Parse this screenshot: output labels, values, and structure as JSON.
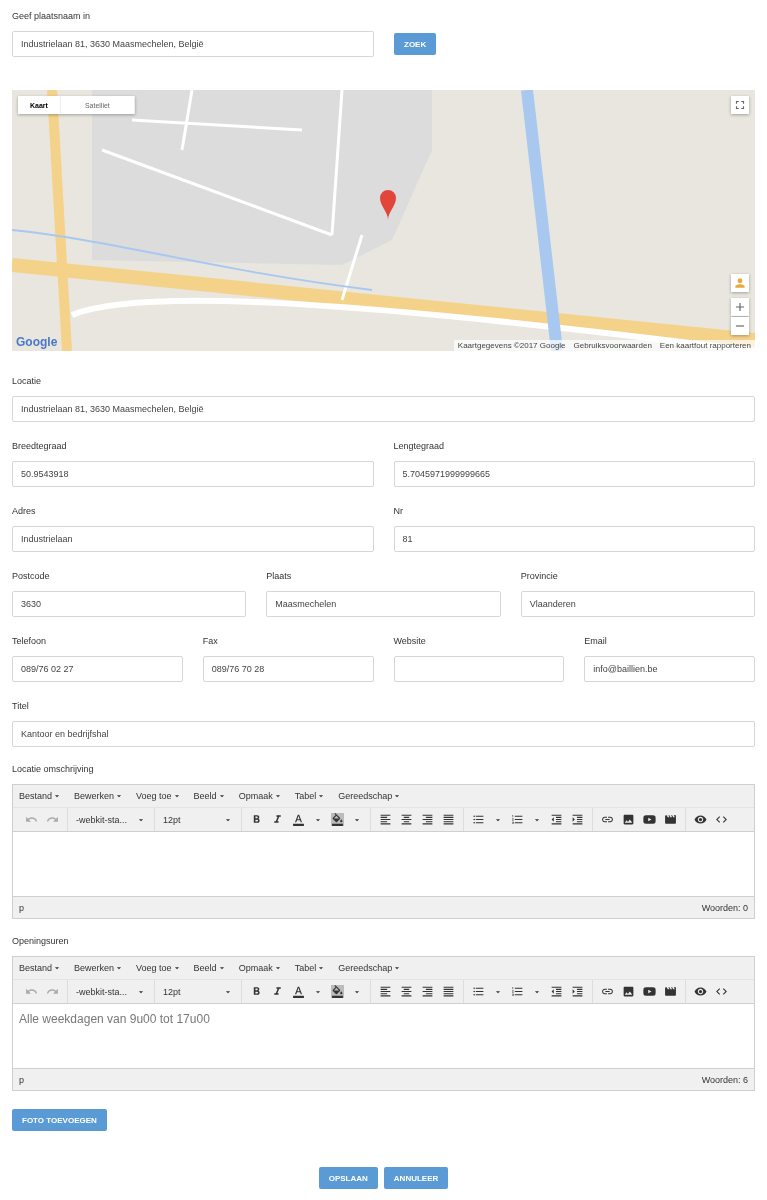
{
  "search": {
    "label": "Geef plaatsnaam in",
    "value": "Industrielaan 81, 3630 Maasmechelen, België",
    "button": "ZOEK"
  },
  "map": {
    "tabs": [
      {
        "label": "Kaart",
        "selected": true
      },
      {
        "label": "Satelliet",
        "selected": false
      }
    ],
    "logo": "Google",
    "attribution": "Kaartgegevens ©2017 Google",
    "links": [
      "Gebruiksvoorwaarden",
      "Een kaartfout rapporteren"
    ]
  },
  "form_rows": [
    [
      {
        "label": "Locatie",
        "value": "Industrielaan 81, 3630 Maasmechelen, België"
      }
    ],
    [
      {
        "label": "Breedtegraad",
        "value": "50.9543918"
      },
      {
        "label": "Lengtegraad",
        "value": "5.7045971999999665"
      }
    ],
    [
      {
        "label": "Adres",
        "value": "Industrielaan"
      },
      {
        "label": "Nr",
        "value": "81"
      }
    ],
    [
      {
        "label": "Postcode",
        "value": "3630"
      },
      {
        "label": "Plaats",
        "value": "Maasmechelen"
      },
      {
        "label": "Provincie",
        "value": "Vlaanderen"
      }
    ],
    [
      {
        "label": "Telefoon",
        "value": "089/76 02 27"
      },
      {
        "label": "Fax",
        "value": "089/76 70 28"
      },
      {
        "label": "Website"
      },
      {
        "label": "Email",
        "value": "info@baillien.be"
      }
    ],
    [
      {
        "label": "Titel",
        "value": "Kantoor en bedrijfshal"
      }
    ]
  ],
  "editors": [
    {
      "label": "Locatie omschrijving",
      "menus": [
        "Bestand",
        "Bewerken",
        "Voeg toe",
        "Beeld",
        "Opmaak",
        "Tabel",
        "Gereedschap"
      ],
      "font_family": "-webkit-sta...",
      "font_size": "12pt",
      "path": "p",
      "word_count": "Woorden: 0"
    },
    {
      "label": "Openingsuren",
      "menus": [
        "Bestand",
        "Bewerken",
        "Voeg toe",
        "Beeld",
        "Opmaak",
        "Tabel",
        "Gereedschap"
      ],
      "font_family": "-webkit-sta...",
      "font_size": "12pt",
      "content": "Alle weekdagen van 9u00 tot 17u00",
      "path": "p",
      "word_count": "Woorden: 6"
    }
  ],
  "photo_button": "FOTO TOEVOEGEN",
  "actions": [
    "OPSLAAN",
    "ANNULEER"
  ]
}
